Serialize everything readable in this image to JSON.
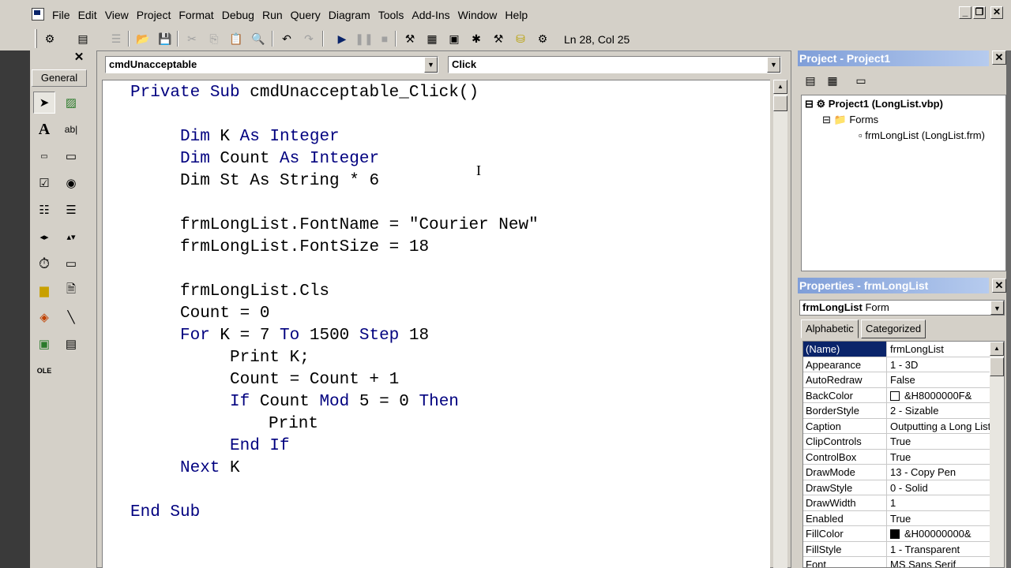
{
  "menu": [
    "File",
    "Edit",
    "View",
    "Project",
    "Format",
    "Debug",
    "Run",
    "Query",
    "Diagram",
    "Tools",
    "Add-Ins",
    "Window",
    "Help"
  ],
  "window_buttons": {
    "minimize": "_",
    "restore": "❐",
    "close": "✕"
  },
  "toolbar": {
    "position": "Ln 28, Col 25"
  },
  "toolbox": {
    "tab_label": "General",
    "close": "✕"
  },
  "code_window": {
    "object_combo": "cmdUnacceptable",
    "procedure_combo": "Click",
    "lines": [
      [
        {
          "t": "Private Sub ",
          "k": 1
        },
        {
          "t": "cmdUnacceptable_Click()",
          "k": 0
        }
      ],
      [
        {
          "t": "Dim ",
          "k": 1
        },
        {
          "t": "K ",
          "k": 0
        },
        {
          "t": "As Integer",
          "k": 1
        }
      ],
      [
        {
          "t": "Dim ",
          "k": 1
        },
        {
          "t": "Count ",
          "k": 0
        },
        {
          "t": "As Integer",
          "k": 1
        }
      ],
      [
        {
          "t": "Dim St As String * 6",
          "k": 0
        }
      ],
      [
        {
          "t": "frmLongList.FontName = \"Courier New\"",
          "k": 0
        }
      ],
      [
        {
          "t": "frmLongList.FontSize = 18",
          "k": 0
        }
      ],
      [
        {
          "t": "frmLongList.Cls",
          "k": 0
        }
      ],
      [
        {
          "t": "Count = 0",
          "k": 0
        }
      ],
      [
        {
          "t": "For ",
          "k": 1
        },
        {
          "t": "K = 7 ",
          "k": 0
        },
        {
          "t": "To ",
          "k": 1
        },
        {
          "t": "1500 ",
          "k": 0
        },
        {
          "t": "Step ",
          "k": 1
        },
        {
          "t": "18",
          "k": 0
        }
      ],
      [
        {
          "t": "Print K;",
          "k": 0
        }
      ],
      [
        {
          "t": "Count = Count + 1",
          "k": 0
        }
      ],
      [
        {
          "t": "If ",
          "k": 1
        },
        {
          "t": "Count ",
          "k": 0
        },
        {
          "t": "Mod ",
          "k": 1
        },
        {
          "t": "5 = 0 ",
          "k": 0
        },
        {
          "t": "Then",
          "k": 1
        }
      ],
      [
        {
          "t": "Print",
          "k": 0
        }
      ],
      [
        {
          "t": "End If",
          "k": 1
        }
      ],
      [
        {
          "t": "Next ",
          "k": 1
        },
        {
          "t": "K",
          "k": 0
        }
      ],
      [
        {
          "t": "End Sub",
          "k": 1
        }
      ]
    ]
  },
  "project_panel": {
    "title": "Project - Project1",
    "close": "✕",
    "tree": [
      "Project1 (LongList.vbp)",
      "Forms",
      "frmLongList (LongList.frm)"
    ]
  },
  "properties_panel": {
    "title": "Properties - frmLongList",
    "close": "✕",
    "object_name": "frmLongList",
    "object_type": "Form",
    "tabs": [
      "Alphabetic",
      "Categorized"
    ],
    "rows": [
      {
        "name": "(Name)",
        "value": "frmLongList"
      },
      {
        "name": "Appearance",
        "value": "1 - 3D"
      },
      {
        "name": "AutoRedraw",
        "value": "False"
      },
      {
        "name": "BackColor",
        "value": "&H8000000F&",
        "swatch": "#ffffff"
      },
      {
        "name": "BorderStyle",
        "value": "2 - Sizable"
      },
      {
        "name": "Caption",
        "value": "Outputting a Long List"
      },
      {
        "name": "ClipControls",
        "value": "True"
      },
      {
        "name": "ControlBox",
        "value": "True"
      },
      {
        "name": "DrawMode",
        "value": "13 - Copy Pen"
      },
      {
        "name": "DrawStyle",
        "value": "0 - Solid"
      },
      {
        "name": "DrawWidth",
        "value": "1"
      },
      {
        "name": "Enabled",
        "value": "True"
      },
      {
        "name": "FillColor",
        "value": "&H00000000&",
        "swatch": "#000000"
      },
      {
        "name": "FillStyle",
        "value": "1 - Transparent"
      },
      {
        "name": "Font",
        "value": "MS Sans Serif"
      }
    ]
  },
  "colors": {
    "keyword": "#00007f",
    "selection": "#0a246a",
    "panel_title": "#7f9ed8"
  }
}
